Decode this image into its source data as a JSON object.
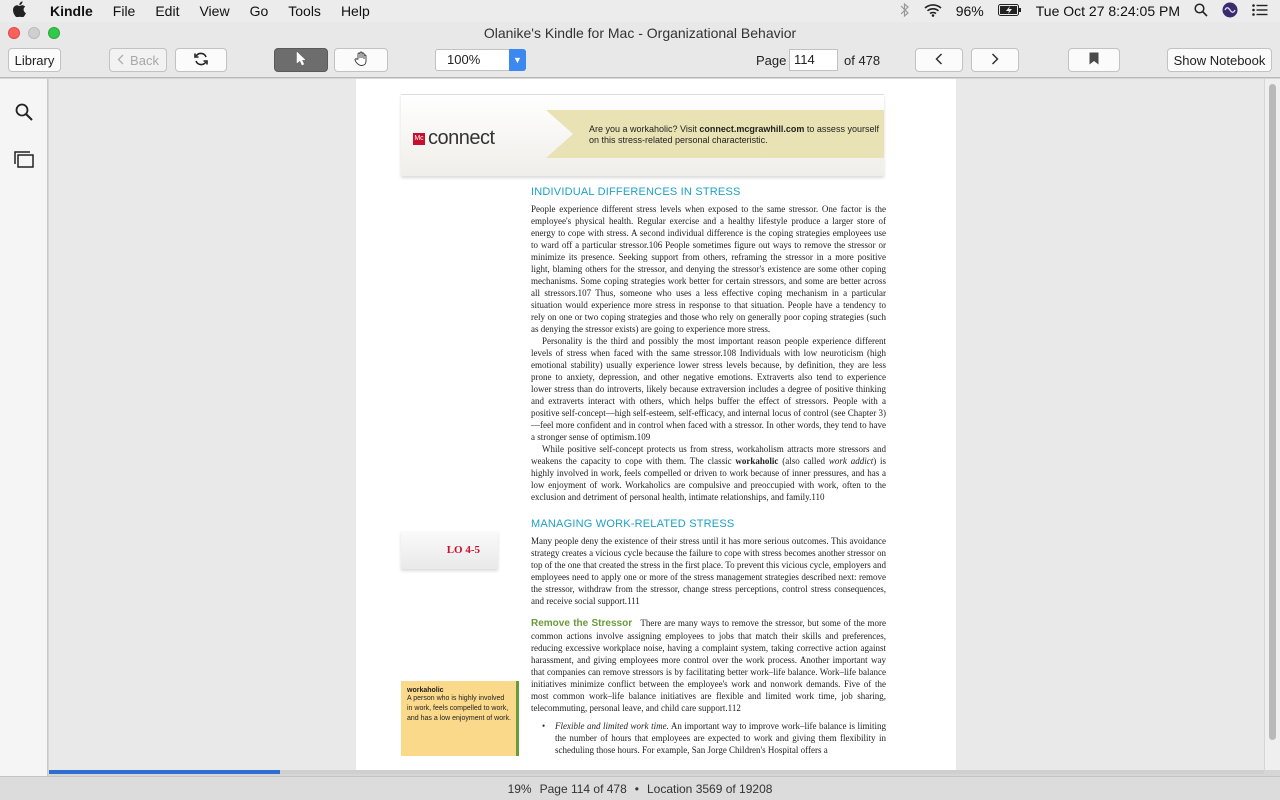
{
  "menubar": {
    "app_name": "Kindle",
    "items": [
      "File",
      "Edit",
      "View",
      "Go",
      "Tools",
      "Help"
    ],
    "battery": "96%",
    "clock": "Tue Oct 27  8:24:05 PM"
  },
  "window": {
    "title": "Olanike's Kindle for Mac - Organizational Behavior"
  },
  "toolbar": {
    "library_label": "Library",
    "back_label": "Back",
    "zoom_value": "100%",
    "page_label": "Page",
    "page_value": "114",
    "page_total": "of 478",
    "show_notebook_label": "Show Notebook"
  },
  "book_page": {
    "banner": {
      "logo_mark": "Mc",
      "logo_text": "connect",
      "text_prefix": "Are you a workaholic? Visit ",
      "text_link": "connect.mcgrawhill.com",
      "text_suffix": " to assess yourself on this stress-related personal characteristic."
    },
    "section1": {
      "heading": "INDIVIDUAL DIFFERENCES IN STRESS",
      "para1": "People experience different stress levels when exposed to the same stressor. One factor is the employee's physical health. Regular exercise and a healthy lifestyle produce a larger store of energy to cope with stress. A second individual difference is the coping strategies employees use to ward off a particular stressor.106 People sometimes figure out ways to remove the stressor or minimize its presence. Seeking support from others, reframing the stressor in a more positive light, blaming others for the stressor, and denying the stressor's existence are some other coping mechanisms. Some coping strategies work better for certain stressors, and some are better across all stressors.107 Thus, someone who uses a less effective coping mechanism in a particular situation would experience more stress in response to that situation. People have a tendency to rely on one or two coping strategies and those who rely on generally poor coping strategies (such as denying the stressor exists) are going to experience more stress.",
      "para2": "Personality is the third and possibly the most important reason people experience different levels of stress when faced with the same stressor.108 Individuals with low neuroticism (high emotional stability) usually experience lower stress levels because, by definition, they are less prone to anxiety, depression, and other negative emotions. Extraverts also tend to experience lower stress than do introverts, likely because extraversion includes a degree of positive thinking and extraverts interact with others, which helps buffer the effect of stressors. People with a positive self-concept—high self-esteem, self-efficacy, and internal locus of control (see Chapter 3)—feel more confident and in control when faced with a stressor. In other words, they tend to have a stronger sense of optimism.109",
      "para3_before": "While positive self-concept protects us from stress, workaholism attracts more stressors and weakens the capacity to cope with them. The classic ",
      "para3_bold": "workaholic",
      "para3_mid": " (also called ",
      "para3_italic": "work addict",
      "para3_after": ") is highly involved in work, feels compelled or driven to work because of inner pressures, and has a low enjoyment of work. Workaholics are compulsive and preoccupied with work, often to the exclusion and detriment of personal health, intimate relationships, and family.110"
    },
    "section2": {
      "heading": "MANAGING WORK-RELATED STRESS",
      "lo_badge": "LO 4-5",
      "para1": "Many people deny the existence of their stress until it has more serious outcomes. This avoidance strategy creates a vicious cycle because the failure to cope with stress becomes another stressor on top of the one that created the stress in the first place. To prevent this vicious cycle, employers and employees need to apply one or more of the stress management strategies described next: remove the stressor, withdraw from the stressor, change stress perceptions, control stress consequences, and receive social support.111",
      "subheading": "Remove the Stressor",
      "para2": "There are many ways to remove the stressor, but some of the more common actions involve assigning employees to jobs that match their skills and preferences, reducing excessive workplace noise, having a complaint system, taking corrective action against harassment, and giving employees more control over the work process. Another important way that companies can remove stressors is by facilitating better work–life balance. Work–life balance initiatives minimize conflict between the employee's work and nonwork demands. Five of the most common work–life balance initiatives are flexible and limited work time, job sharing, telecommuting, personal leave, and child care support.112",
      "bullet_italic": "Flexible and limited work time.",
      "bullet_text": " An important way to improve work–life balance is limiting the number of hours that employees are expected to work and giving them flexibility in scheduling those hours. For example, San Jorge Children's Hospital offers a"
    },
    "definition": {
      "term": "workaholic",
      "text": "A person who is highly involved in work, feels compelled to work, and has a low enjoyment of work."
    }
  },
  "progress": {
    "fraction": 0.19
  },
  "status": {
    "percent": "19%",
    "page": "Page 114 of 478",
    "separator": "•",
    "location": "Location 3569 of 19208"
  },
  "colors": {
    "accent_heading": "#1da1c6",
    "subheading_green": "#6b9a3b",
    "progress_blue": "#2f6ed1"
  }
}
